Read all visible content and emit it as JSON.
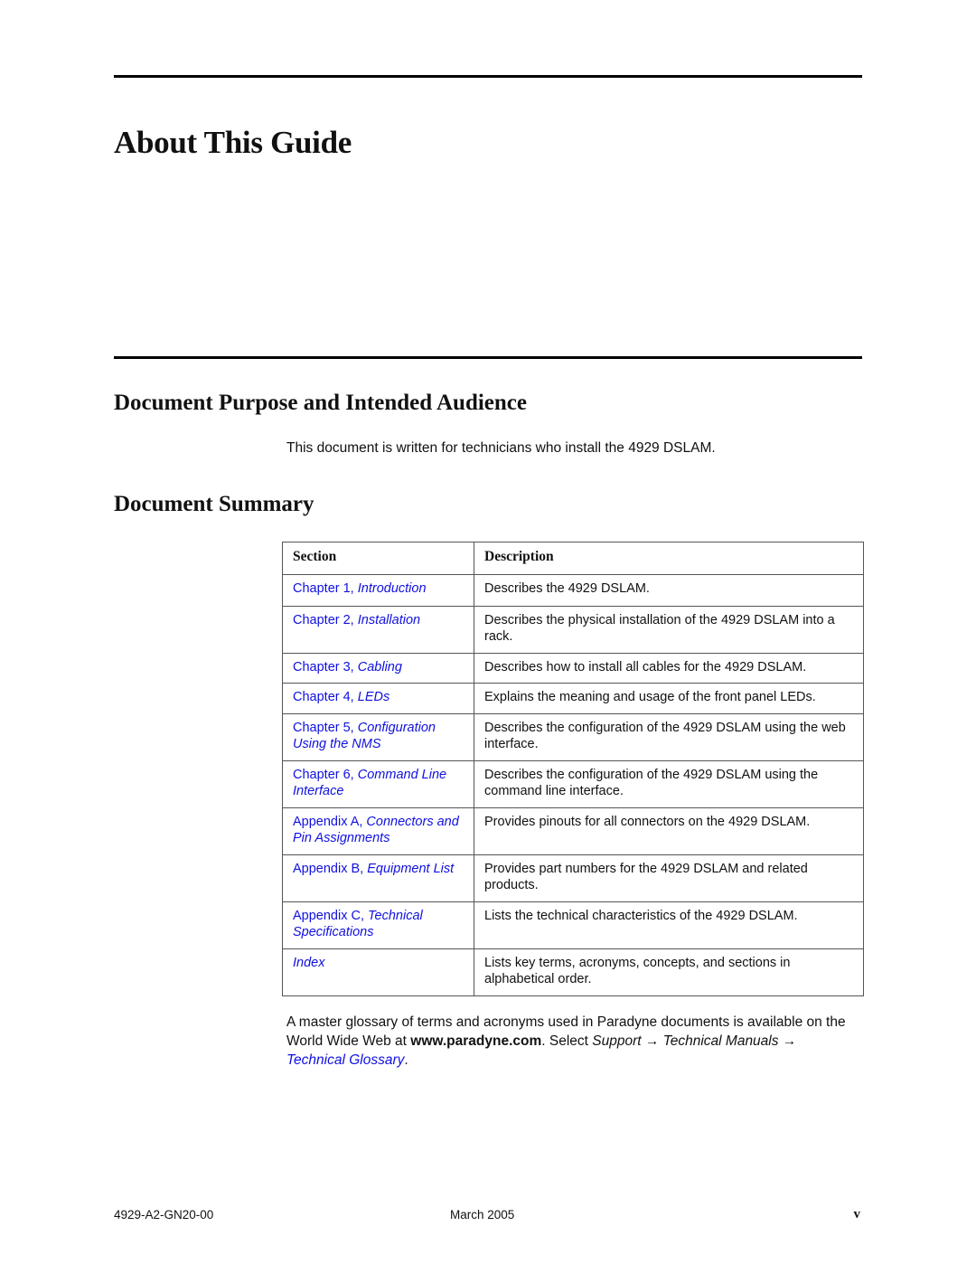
{
  "page": {
    "title": "About This Guide",
    "section1": {
      "heading": "Document Purpose and Intended Audience",
      "body": "This document is written for technicians who install the 4929 DSLAM."
    },
    "section2": {
      "heading": "Document Summary",
      "table": {
        "headers": [
          "Section",
          "Description"
        ],
        "rows": [
          {
            "prefix": "Chapter 1, ",
            "title": "Introduction",
            "description": "Describes the 4929 DSLAM."
          },
          {
            "prefix": "Chapter 2, ",
            "title": "Installation",
            "description": "Describes the physical installation of the 4929 DSLAM into a rack."
          },
          {
            "prefix": "Chapter 3, ",
            "title": "Cabling",
            "description": "Describes how to install all cables for the 4929 DSLAM."
          },
          {
            "prefix": "Chapter 4, ",
            "title": "LEDs",
            "description": "Explains the meaning and usage of the front panel LEDs."
          },
          {
            "prefix": "Chapter 5, ",
            "title": "Configuration Using the NMS",
            "description": "Describes the configuration of the 4929 DSLAM using the web interface."
          },
          {
            "prefix": "Chapter 6, ",
            "title": "Command Line Interface",
            "description": "Describes the configuration of the 4929 DSLAM using the command line interface."
          },
          {
            "prefix": "Appendix A, ",
            "title": "Connectors and Pin Assignments",
            "description": "Provides pinouts for all connectors on the 4929 DSLAM."
          },
          {
            "prefix": "Appendix B, ",
            "title": "Equipment List",
            "description": "Provides part numbers for the 4929 DSLAM and related products."
          },
          {
            "prefix": "Appendix C, ",
            "title": "Technical Specifications",
            "description": "Lists the technical characteristics of the 4929 DSLAM."
          },
          {
            "prefix": "",
            "title": "Index",
            "description": "Lists key terms, acronyms, concepts, and sections in alphabetical order."
          }
        ]
      },
      "glossary_note": {
        "text1": "A master glossary of terms and acronyms used in Paradyne documents is available on the World Wide Web at ",
        "url": "www.paradyne.com",
        "text2": ". Select ",
        "step1": "Support",
        "arrow": " → ",
        "step2": "Technical Manuals",
        "step3": "Technical Glossary",
        "end": "."
      }
    },
    "footer": {
      "doc_number": "4929-A2-GN20-00",
      "date": "March 2005",
      "page_number": "v"
    },
    "colors": {
      "link": "#1010e0",
      "rule": "#000000"
    }
  }
}
